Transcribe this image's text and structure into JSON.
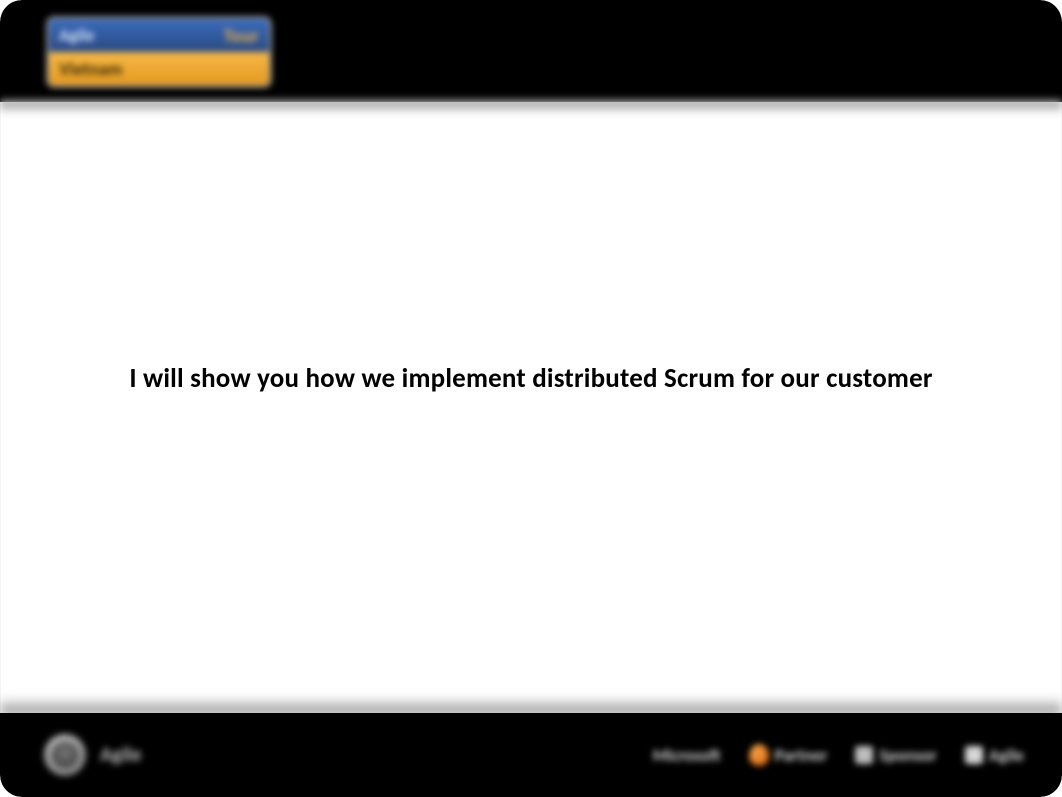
{
  "header": {
    "logo_top_left": "Agile",
    "logo_top_right": "Tour",
    "logo_bottom": "Vietnam"
  },
  "main": {
    "heading": "I will show you how we implement distributed Scrum for our customer"
  },
  "footer": {
    "left_text": "Agile",
    "partners": [
      {
        "name": "Microsoft"
      },
      {
        "name": "Partner"
      },
      {
        "name": "Sponsor"
      },
      {
        "name": "Agile"
      }
    ]
  }
}
